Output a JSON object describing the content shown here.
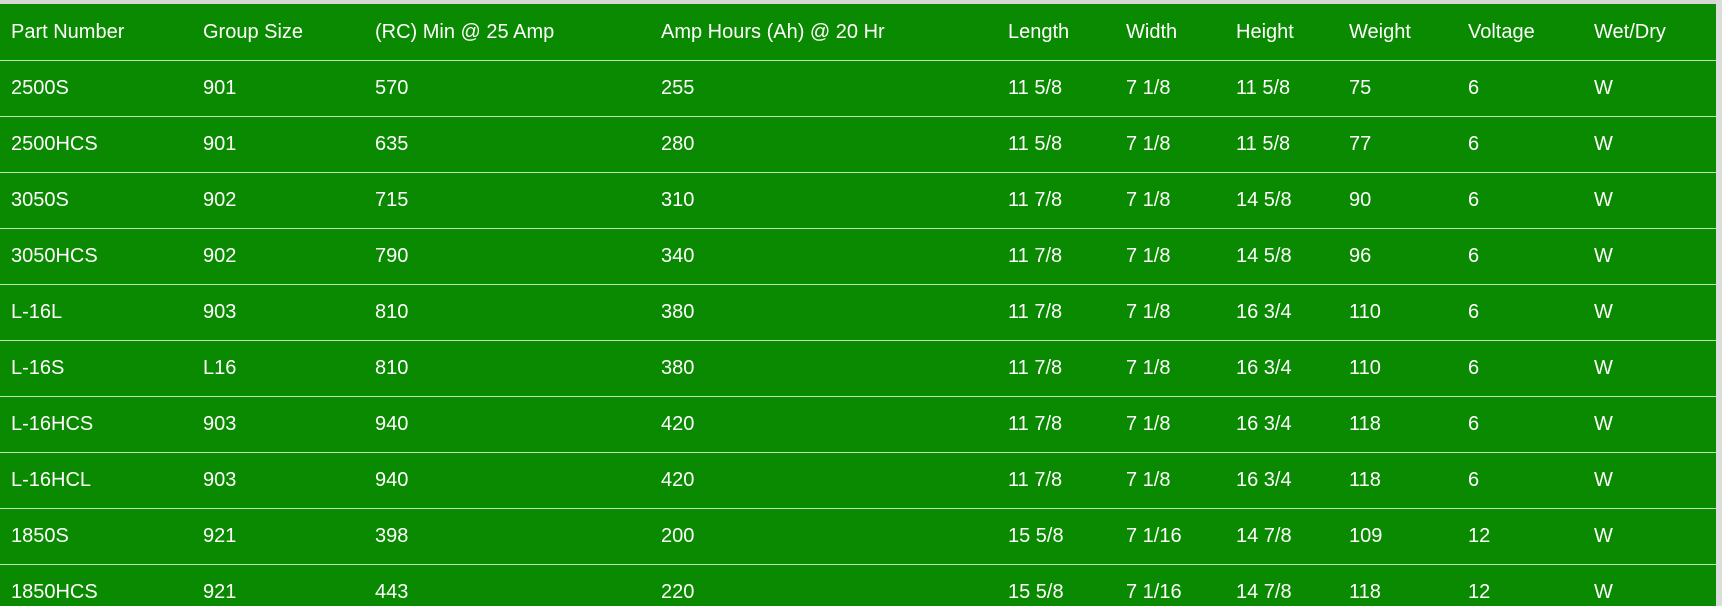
{
  "table": {
    "headers": [
      "Part Number",
      "Group Size",
      "(RC) Min @ 25 Amp",
      "Amp Hours (Ah) @ 20 Hr",
      "Length",
      "Width",
      "Height",
      "Weight",
      "Voltage",
      "Wet/Dry"
    ],
    "rows": [
      [
        "2500S",
        "901",
        "570",
        "255",
        "11 5/8",
        "7 1/8",
        "11 5/8",
        "75",
        "6",
        "W"
      ],
      [
        "2500HCS",
        "901",
        "635",
        "280",
        "11 5/8",
        "7 1/8",
        "11 5/8",
        "77",
        "6",
        "W"
      ],
      [
        "3050S",
        "902",
        "715",
        "310",
        "11 7/8",
        "7 1/8",
        "14 5/8",
        "90",
        "6",
        "W"
      ],
      [
        "3050HCS",
        "902",
        "790",
        "340",
        "11 7/8",
        "7 1/8",
        "14 5/8",
        "96",
        "6",
        "W"
      ],
      [
        "L-16L",
        "903",
        "810",
        "380",
        "11 7/8",
        "7 1/8",
        "16 3/4",
        "110",
        "6",
        "W"
      ],
      [
        "L-16S",
        "L16",
        "810",
        "380",
        "11 7/8",
        "7 1/8",
        "16 3/4",
        "110",
        "6",
        "W"
      ],
      [
        "L-16HCS",
        "903",
        "940",
        "420",
        "11 7/8",
        "7 1/8",
        "16 3/4",
        "118",
        "6",
        "W"
      ],
      [
        "L-16HCL",
        "903",
        "940",
        "420",
        "11 7/8",
        "7 1/8",
        "16 3/4",
        "118",
        "6",
        "W"
      ],
      [
        "1850S",
        "921",
        "398",
        "200",
        "15 5/8",
        "7 1/16",
        "14 7/8",
        "109",
        "12",
        "W"
      ],
      [
        "1850HCS",
        "921",
        "443",
        "220",
        "15 5/8",
        "7 1/16",
        "14 7/8",
        "118",
        "12",
        "W"
      ]
    ]
  },
  "colors": {
    "background": "#0a8a00",
    "text": "#ffffff",
    "row_divider": "#bfe3b8"
  }
}
